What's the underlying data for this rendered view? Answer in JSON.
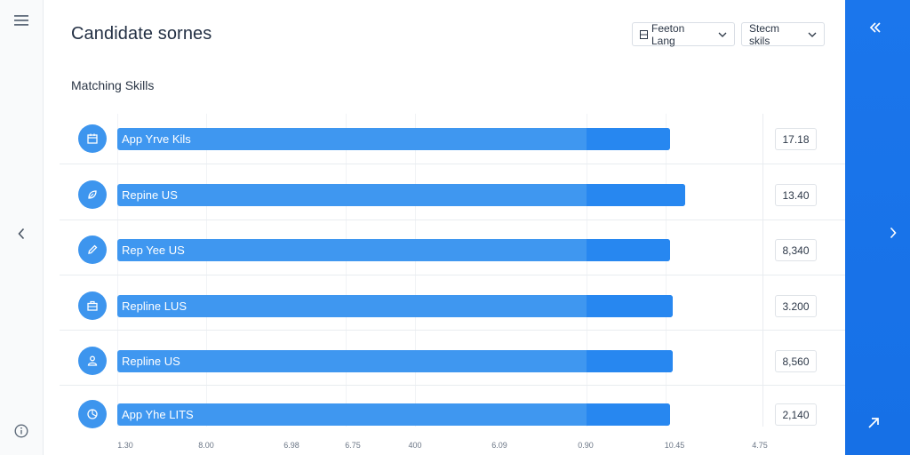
{
  "header": {
    "title": "Candidate sornes",
    "filter1": {
      "icon": "grid-icon",
      "label": "Feeton Lang"
    },
    "filter2": {
      "label": "Stecm skils"
    }
  },
  "section": {
    "title": "Matching Skills"
  },
  "chart_data": {
    "type": "bar",
    "orientation": "horizontal",
    "categories": [
      "App Yrve Kils",
      "Repine US",
      "Rep Yee US",
      "Repline LUS",
      "Repline US",
      "App Yhe LITS"
    ],
    "values": [
      0.805,
      0.827,
      0.805,
      0.809,
      0.809,
      0.805
    ],
    "values_note_unit": "fraction",
    "value_labels": [
      "17.18",
      "13.40",
      "8,340",
      "3.200",
      "8,560",
      "2,140"
    ],
    "x_ticks": [
      "1.30",
      "8.00",
      "6.98",
      "6.75",
      "400",
      "6.09",
      "0.90",
      "10.45",
      "4.75"
    ],
    "grid": true,
    "title": "Matching Skills",
    "colors": {
      "bar": "#3f97f0",
      "bar_end": "#2787f0"
    }
  },
  "row_icons": [
    "calendar-icon",
    "leaf-icon",
    "pencil-icon",
    "briefcase-icon",
    "user-icon",
    "chart-icon"
  ],
  "colors": {
    "accent": "#1a73e8",
    "bar": "#3f97f0"
  }
}
